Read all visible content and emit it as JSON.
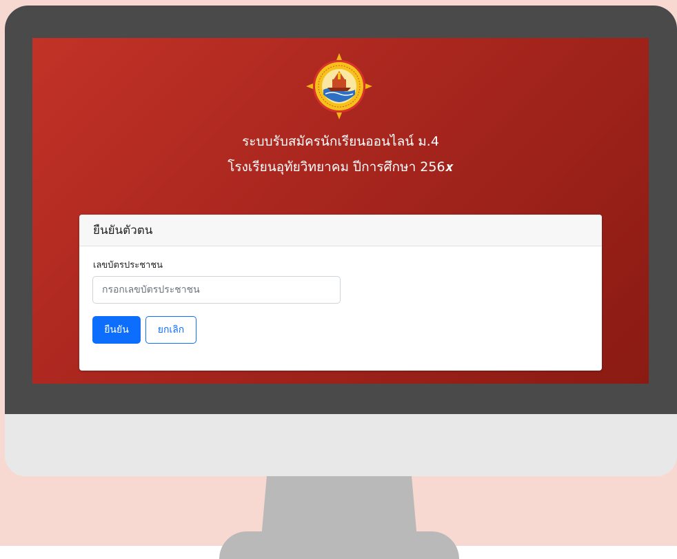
{
  "header": {
    "title_line1": "ระบบรับสมัครนักเรียนออนไลน์ ม.4",
    "title_line2": "โรงเรียนอุทัยวิทยาคม ปีการศึกษา 256𝒙"
  },
  "card": {
    "title": "ยืนยันตัวตน",
    "field_label": "เลขบัตรประชาชน",
    "input_placeholder": "กรอกเลขบัตรประชาชน",
    "input_value": "",
    "confirm_label": "ยืนยัน",
    "cancel_label": "ยกเลิก"
  },
  "colors": {
    "page_background": "#f7d9d2",
    "screen_red": "#a8261e",
    "primary": "#0d6efd",
    "bezel": "#4a4a4a"
  },
  "icons": {
    "logo": "school-emblem"
  }
}
